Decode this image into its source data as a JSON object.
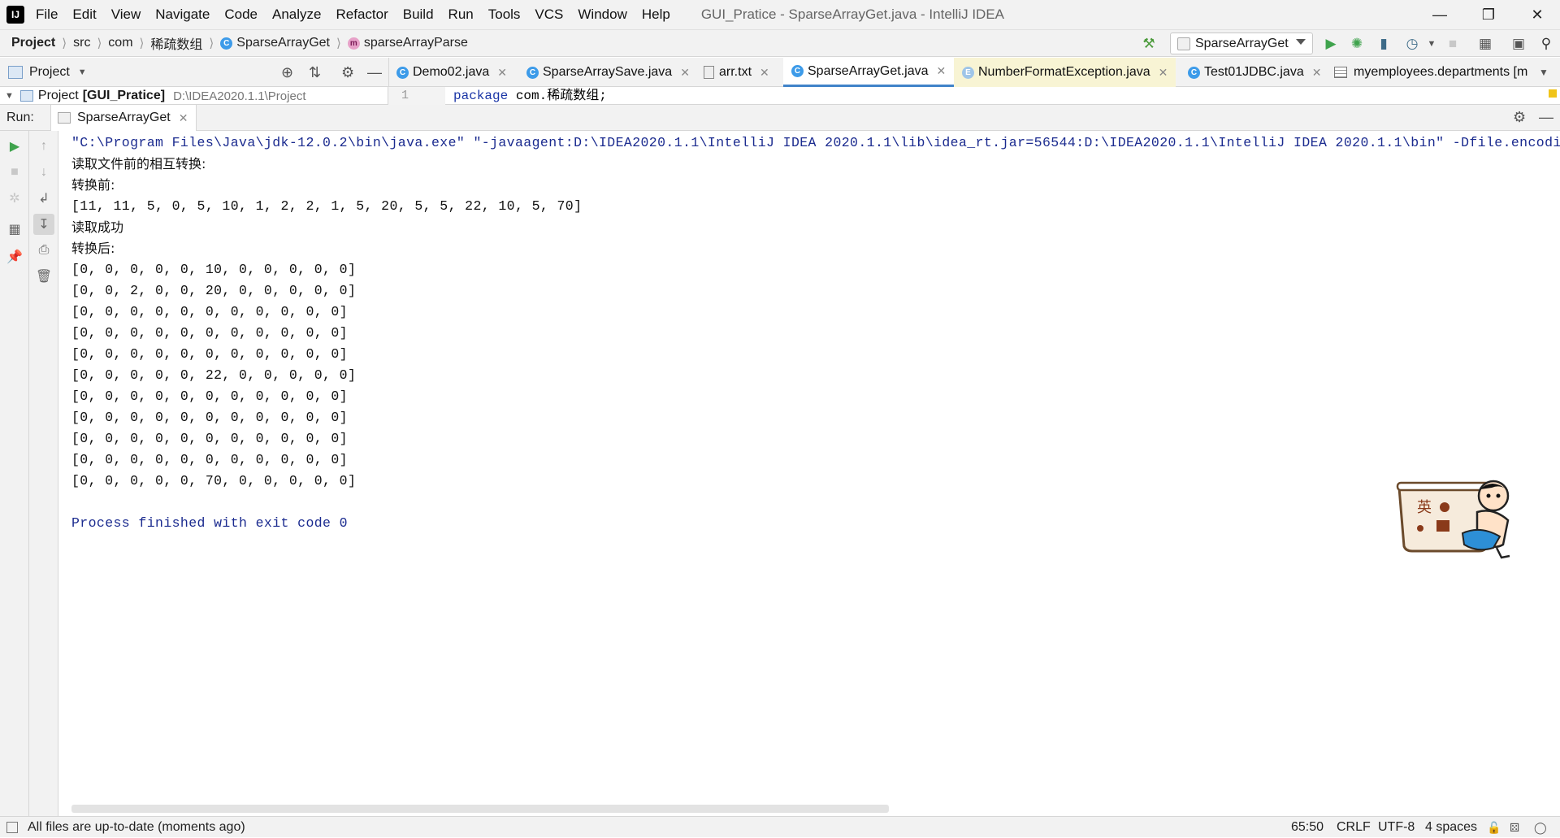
{
  "app": {
    "menu": [
      "File",
      "Edit",
      "View",
      "Navigate",
      "Code",
      "Analyze",
      "Refactor",
      "Build",
      "Run",
      "Tools",
      "VCS",
      "Window",
      "Help"
    ],
    "window_title": "GUI_Pratice - SparseArrayGet.java - IntelliJ IDEA"
  },
  "breadcrumb": {
    "items": [
      "Project",
      "src",
      "com",
      "稀疏数组",
      "SparseArrayGet",
      "sparseArrayParse"
    ]
  },
  "toolbar": {
    "run_config": "SparseArrayGet"
  },
  "project_panel": {
    "title": "Project",
    "root_label": "Project",
    "root_module": "[GUI_Pratice]",
    "root_path": "D:\\IDEA2020.1.1\\Project"
  },
  "tabs": [
    {
      "label": "Demo02.java"
    },
    {
      "label": "SparseArraySave.java"
    },
    {
      "label": "arr.txt"
    },
    {
      "label": "SparseArrayGet.java"
    },
    {
      "label": "NumberFormatException.java"
    },
    {
      "label": "Test01JDBC.java"
    },
    {
      "label": "myemployees.departments [m"
    }
  ],
  "editor": {
    "line_number": "1",
    "keyword": "package",
    "rest": " com.稀疏数组;"
  },
  "run_panel": {
    "label": "Run:",
    "tab": "SparseArrayGet"
  },
  "console": {
    "command": "\"C:\\Program Files\\Java\\jdk-12.0.2\\bin\\java.exe\" \"-javaagent:D:\\IDEA2020.1.1\\IntelliJ IDEA 2020.1.1\\lib\\idea_rt.jar=56544:D:\\IDEA2020.1.1\\IntelliJ IDEA 2020.1.1\\bin\" -Dfile.encoding=GBK",
    "lines": [
      "读取文件前的相互转换:",
      "转换前:",
      "[11, 11, 5, 0, 5, 10, 1, 2, 2, 1, 5, 20, 5, 5, 22, 10, 5, 70]",
      "读取成功",
      "转换后:",
      "[0, 0, 0, 0, 0, 10, 0, 0, 0, 0, 0]",
      "[0, 0, 2, 0, 0, 20, 0, 0, 0, 0, 0]",
      "[0, 0, 0, 0, 0, 0, 0, 0, 0, 0, 0]",
      "[0, 0, 0, 0, 0, 0, 0, 0, 0, 0, 0]",
      "[0, 0, 0, 0, 0, 0, 0, 0, 0, 0, 0]",
      "[0, 0, 0, 0, 0, 22, 0, 0, 0, 0, 0]",
      "[0, 0, 0, 0, 0, 0, 0, 0, 0, 0, 0]",
      "[0, 0, 0, 0, 0, 0, 0, 0, 0, 0, 0]",
      "[0, 0, 0, 0, 0, 0, 0, 0, 0, 0, 0]",
      "[0, 0, 0, 0, 0, 0, 0, 0, 0, 0, 0]",
      "[0, 0, 0, 0, 0, 70, 0, 0, 0, 0, 0]"
    ],
    "exit": "Process finished with exit code 0"
  },
  "status": {
    "message": "All files are up-to-date (moments ago)",
    "position": "65:50",
    "line_sep": "CRLF",
    "encoding": "UTF-8",
    "indent": "4 spaces"
  },
  "mascot": {
    "text": "英"
  },
  "colors": {
    "accent": "#4083c9",
    "console_blue": "#1b2b8f",
    "run_green": "#3fa34d"
  }
}
